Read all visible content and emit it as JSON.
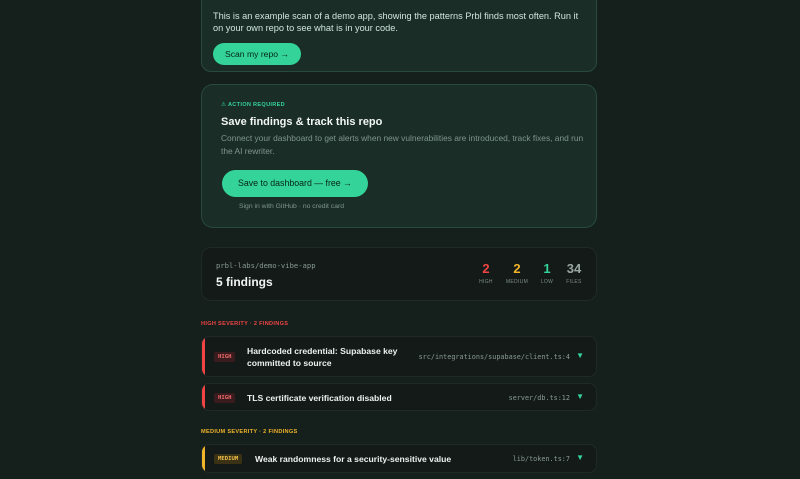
{
  "demo": {
    "text": "This is an example scan of a demo app, showing the patterns Prbl finds most often. Run it on your own repo to see what is in your code.",
    "button": "Scan my repo →"
  },
  "action": {
    "eyebrow": "⚠ ACTION REQUIRED",
    "title": "Save findings & track this repo",
    "description": "Connect your dashboard to get alerts when new vulnerabilities are introduced, track fixes, and run the AI rewriter.",
    "button": "Save to dashboard — free →",
    "note": "Sign in with GitHub · no credit card"
  },
  "summary": {
    "repo": "prbl-labs/demo-vibe-app",
    "findings": "5 findings",
    "stats": [
      {
        "value": "2",
        "label": "HIGH",
        "color": "#f04444"
      },
      {
        "value": "2",
        "label": "MEDIUM",
        "color": "#f0b429"
      },
      {
        "value": "1",
        "label": "LOW",
        "color": "#34d399"
      },
      {
        "value": "34",
        "label": "FILES",
        "color": "#9aa6a2"
      }
    ]
  },
  "sections": {
    "high": {
      "label": "HIGH SEVERITY · 2 FINDINGS",
      "color": "#f04444"
    },
    "medium": {
      "label": "MEDIUM SEVERITY · 2 FINDINGS",
      "color": "#f0b429"
    }
  },
  "findings": [
    {
      "badge": "HIGH",
      "title": "Hardcoded credential: Supabase key committed to source",
      "path": "src/integrations/supabase/client.ts:4",
      "icon": "chevron-down-icon"
    },
    {
      "badge": "HIGH",
      "title": "TLS certificate verification disabled",
      "path": "server/db.ts:12",
      "icon": "chevron-down-icon"
    },
    {
      "badge": "MEDIUM",
      "title": "Weak randomness for a security-sensitive value",
      "path": "lib/token.ts:7",
      "icon": "chevron-down-icon"
    }
  ]
}
